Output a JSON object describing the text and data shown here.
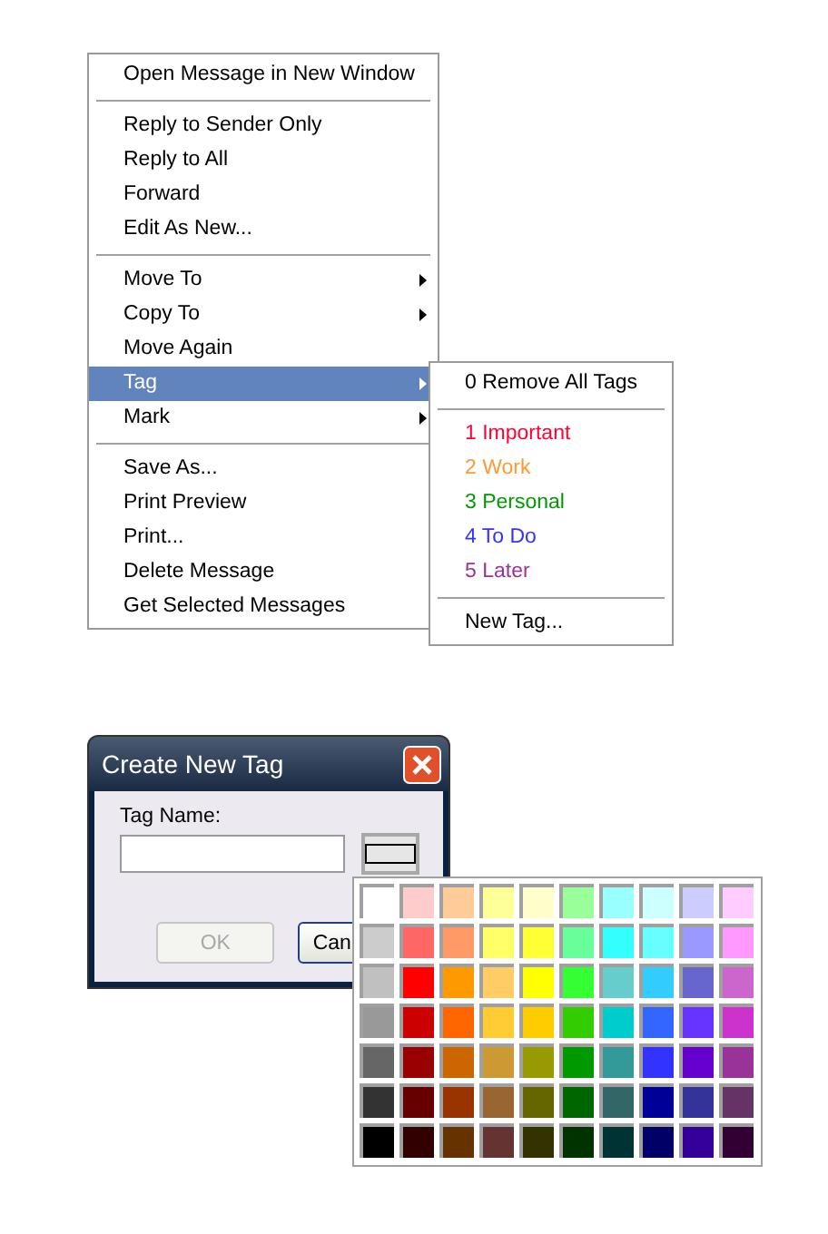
{
  "context_menu": {
    "items": [
      {
        "kind": "item",
        "label": "Open Message in New Window",
        "submenu": false,
        "selected": false
      },
      {
        "kind": "separator"
      },
      {
        "kind": "item",
        "label": "Reply to Sender Only",
        "submenu": false,
        "selected": false
      },
      {
        "kind": "item",
        "label": "Reply to All",
        "submenu": false,
        "selected": false
      },
      {
        "kind": "item",
        "label": "Forward",
        "submenu": false,
        "selected": false
      },
      {
        "kind": "item",
        "label": "Edit As New...",
        "submenu": false,
        "selected": false
      },
      {
        "kind": "separator"
      },
      {
        "kind": "item",
        "label": "Move To",
        "submenu": true,
        "selected": false
      },
      {
        "kind": "item",
        "label": "Copy To",
        "submenu": true,
        "selected": false
      },
      {
        "kind": "item",
        "label": "Move Again",
        "submenu": false,
        "selected": false
      },
      {
        "kind": "item",
        "label": "Tag",
        "submenu": true,
        "selected": true
      },
      {
        "kind": "item",
        "label": "Mark",
        "submenu": true,
        "selected": false
      },
      {
        "kind": "separator"
      },
      {
        "kind": "item",
        "label": "Save As...",
        "submenu": false,
        "selected": false
      },
      {
        "kind": "item",
        "label": "Print Preview",
        "submenu": false,
        "selected": false
      },
      {
        "kind": "item",
        "label": "Print...",
        "submenu": false,
        "selected": false
      },
      {
        "kind": "item",
        "label": "Delete Message",
        "submenu": false,
        "selected": false
      },
      {
        "kind": "item",
        "label": "Get Selected Messages",
        "submenu": false,
        "selected": false
      }
    ]
  },
  "tag_submenu": {
    "items": [
      {
        "kind": "item",
        "label": "0 Remove All Tags"
      },
      {
        "kind": "separator"
      },
      {
        "kind": "tag",
        "label": "1 Important",
        "color": "#ff0033"
      },
      {
        "kind": "tag",
        "label": "2 Work",
        "color": "#ff9933"
      },
      {
        "kind": "tag",
        "label": "3 Personal",
        "color": "#009900"
      },
      {
        "kind": "tag",
        "label": "4 To Do",
        "color": "#3333ff"
      },
      {
        "kind": "tag",
        "label": "5 Later",
        "color": "#993399"
      },
      {
        "kind": "separator"
      },
      {
        "kind": "item",
        "label": "New Tag..."
      }
    ]
  },
  "dialog": {
    "title": "Create New Tag",
    "field_label": "Tag Name:",
    "buttons": [
      {
        "label": "OK",
        "disabled": true
      },
      {
        "label": "Can",
        "disabled": false
      }
    ]
  },
  "color_palette": {
    "rows": [
      [
        {
          "color": "#ffffff"
        },
        {
          "color": "#ffcccc"
        },
        {
          "color": "#ffcc99"
        },
        {
          "color": "#ffff99"
        },
        {
          "color": "#ffffcc"
        },
        {
          "color": "#99ff99"
        },
        {
          "color": "#99ffff"
        },
        {
          "color": "#ccffff"
        },
        {
          "color": "#ccccff"
        },
        {
          "color": "#ffccff"
        }
      ],
      [
        {
          "color": "#cccccc"
        },
        {
          "color": "#ff6666"
        },
        {
          "color": "#ff9966"
        },
        {
          "color": "#ffff66"
        },
        {
          "color": "#ffff33"
        },
        {
          "color": "#66ff99"
        },
        {
          "color": "#33ffff"
        },
        {
          "color": "#66ffff"
        },
        {
          "color": "#9999ff"
        },
        {
          "color": "#ff99ff"
        }
      ],
      [
        {
          "color": "#c0c0c0"
        },
        {
          "color": "#ff0000"
        },
        {
          "color": "#ff9900"
        },
        {
          "color": "#ffcc66"
        },
        {
          "color": "#ffff00"
        },
        {
          "color": "#33ff33"
        },
        {
          "color": "#66cccc"
        },
        {
          "color": "#33ccff"
        },
        {
          "color": "#6666cc"
        },
        {
          "color": "#cc66cc"
        }
      ],
      [
        {
          "color": "#999999"
        },
        {
          "color": "#cc0000"
        },
        {
          "color": "#ff6600"
        },
        {
          "color": "#ffcc33"
        },
        {
          "color": "#ffcc00"
        },
        {
          "color": "#33cc00"
        },
        {
          "color": "#00cccc"
        },
        {
          "color": "#3366ff"
        },
        {
          "color": "#6633ff"
        },
        {
          "color": "#cc33cc"
        }
      ],
      [
        {
          "color": "#666666"
        },
        {
          "color": "#990000"
        },
        {
          "color": "#cc6600"
        },
        {
          "color": "#cc9933"
        },
        {
          "color": "#999900"
        },
        {
          "color": "#009900"
        },
        {
          "color": "#339999"
        },
        {
          "color": "#3333ff"
        },
        {
          "color": "#6600cc"
        },
        {
          "color": "#993399"
        }
      ],
      [
        {
          "color": "#333333"
        },
        {
          "color": "#660000"
        },
        {
          "color": "#993300"
        },
        {
          "color": "#996633"
        },
        {
          "color": "#666600"
        },
        {
          "color": "#006600"
        },
        {
          "color": "#336666"
        },
        {
          "color": "#000099"
        },
        {
          "color": "#333399"
        },
        {
          "color": "#663366"
        }
      ],
      [
        {
          "color": "#000000"
        },
        {
          "color": "#330000"
        },
        {
          "color": "#663300"
        },
        {
          "color": "#663333"
        },
        {
          "color": "#333300"
        },
        {
          "color": "#003300"
        },
        {
          "color": "#003333"
        },
        {
          "color": "#000066"
        },
        {
          "color": "#330099"
        },
        {
          "color": "#330033"
        }
      ]
    ]
  }
}
